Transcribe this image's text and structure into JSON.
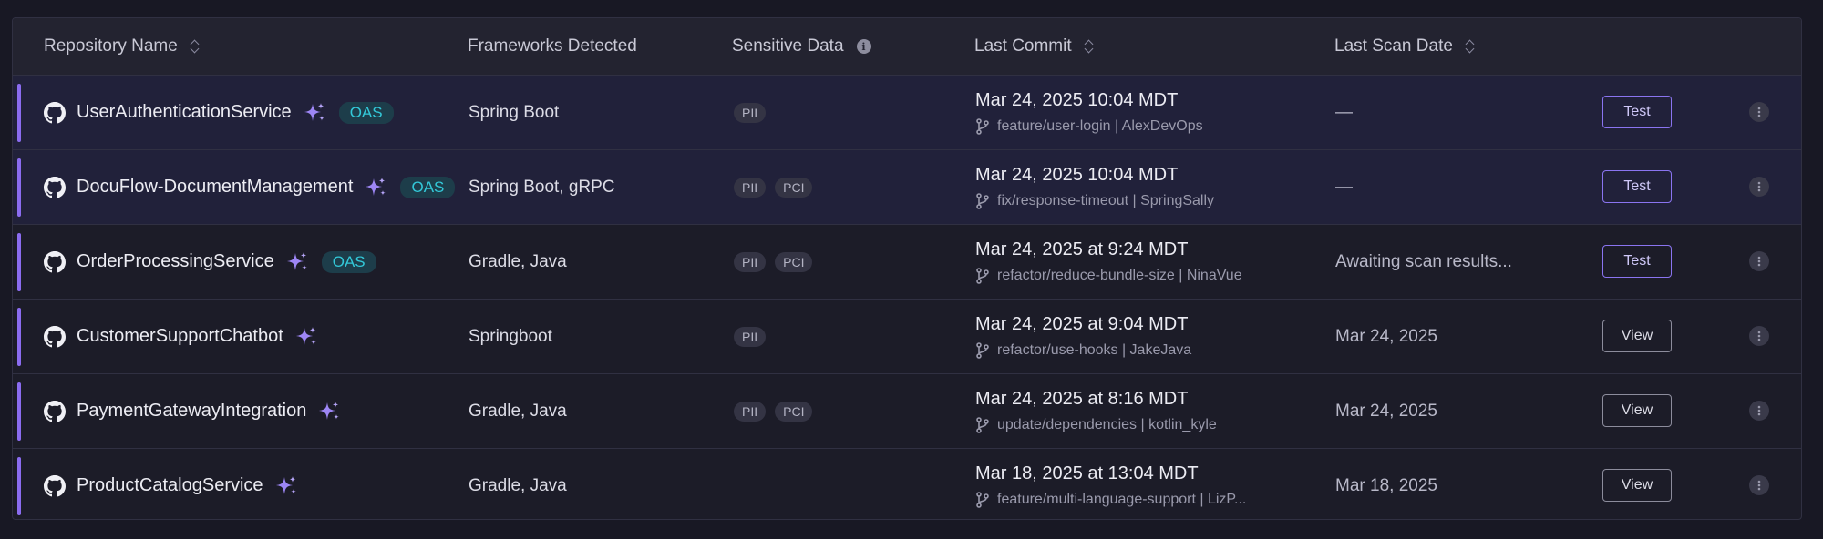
{
  "table": {
    "columns": [
      {
        "label": "Repository Name",
        "sortable": true
      },
      {
        "label": "Frameworks Detected",
        "sortable": false
      },
      {
        "label": "Sensitive Data",
        "sortable": false,
        "info": true
      },
      {
        "label": "Last Commit",
        "sortable": true
      },
      {
        "label": "Last Scan Date",
        "sortable": true
      }
    ],
    "rows": [
      {
        "name": "UserAuthenticationService",
        "oas": "OAS",
        "frameworks": "Spring Boot",
        "sensitive": [
          "PII"
        ],
        "commit_date": "Mar 24, 2025 10:04 MDT",
        "commit_branch": "feature/user-login | AlexDevOps",
        "scan_date": "—",
        "action": "Test",
        "highlighted": true
      },
      {
        "name": "DocuFlow-DocumentManagement",
        "oas": "OAS",
        "frameworks": "Spring Boot, gRPC",
        "sensitive": [
          "PII",
          "PCI"
        ],
        "commit_date": "Mar 24, 2025 10:04 MDT",
        "commit_branch": "fix/response-timeout | SpringSally",
        "scan_date": "—",
        "action": "Test",
        "highlighted": true
      },
      {
        "name": "OrderProcessingService",
        "oas": "OAS",
        "frameworks": "Gradle, Java",
        "sensitive": [
          "PII",
          "PCI"
        ],
        "commit_date": "Mar 24, 2025 at 9:24 MDT",
        "commit_branch": "refactor/reduce-bundle-size | NinaVue",
        "scan_date": "Awaiting scan results...",
        "action": "Test",
        "highlighted": false
      },
      {
        "name": "CustomerSupportChatbot",
        "oas": "",
        "frameworks": "Springboot",
        "sensitive": [
          "PII"
        ],
        "commit_date": "Mar 24, 2025 at 9:04 MDT",
        "commit_branch": "refactor/use-hooks | JakeJava",
        "scan_date": "Mar 24, 2025",
        "action": "View",
        "highlighted": false
      },
      {
        "name": "PaymentGatewayIntegration",
        "oas": "",
        "frameworks": "Gradle, Java",
        "sensitive": [
          "PII",
          "PCI"
        ],
        "commit_date": "Mar 24, 2025 at 8:16 MDT",
        "commit_branch": "update/dependencies | kotlin_kyle",
        "scan_date": "Mar 24, 2025",
        "action": "View",
        "highlighted": false
      },
      {
        "name": "ProductCatalogService",
        "oas": "",
        "frameworks": "Gradle, Java",
        "sensitive": [],
        "commit_date": "Mar 18, 2025 at 13:04 MDT",
        "commit_branch": "feature/multi-language-support | LizP...",
        "scan_date": "Mar 18, 2025",
        "action": "View",
        "highlighted": false
      }
    ]
  },
  "icons": {
    "repo": "github-icon",
    "ai": "sparkle-icon",
    "branch": "git-branch-icon",
    "more": "more-vertical-icon",
    "info": "info-icon",
    "sort": "sort-icon"
  },
  "colors": {
    "accent": "#8b6cf0",
    "oas_text": "#33c8d8",
    "oas_bg": "#1d3d4a",
    "background": "#181824"
  }
}
